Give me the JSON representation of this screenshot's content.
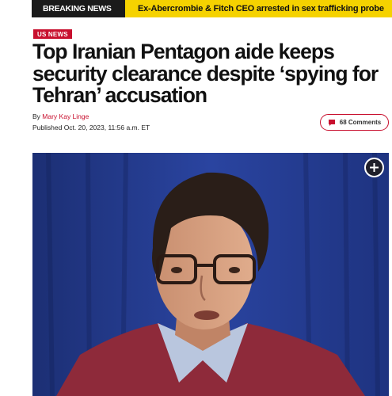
{
  "ticker": {
    "label": "BREAKING NEWS",
    "headline": "Ex-Abercrombie & Fitch CEO arrested in sex trafficking probe"
  },
  "article": {
    "section": "US NEWS",
    "title": "Top Iranian Pentagon aide keeps security clearance despite ‘spying for Tehran’ accusation",
    "byline_prefix": "By",
    "author": "Mary Kay Linge",
    "published": "Published Oct. 20, 2023, 11:56 a.m. ET",
    "comments_label": "68 Comments"
  },
  "icons": {
    "comment": "comment-bubble-icon",
    "expand": "plus-circle-icon"
  },
  "colors": {
    "accent": "#c8102e",
    "ticker_yellow": "#f5d200",
    "ticker_dark": "#1a1a1a",
    "photo_backdrop": "#233a86"
  }
}
